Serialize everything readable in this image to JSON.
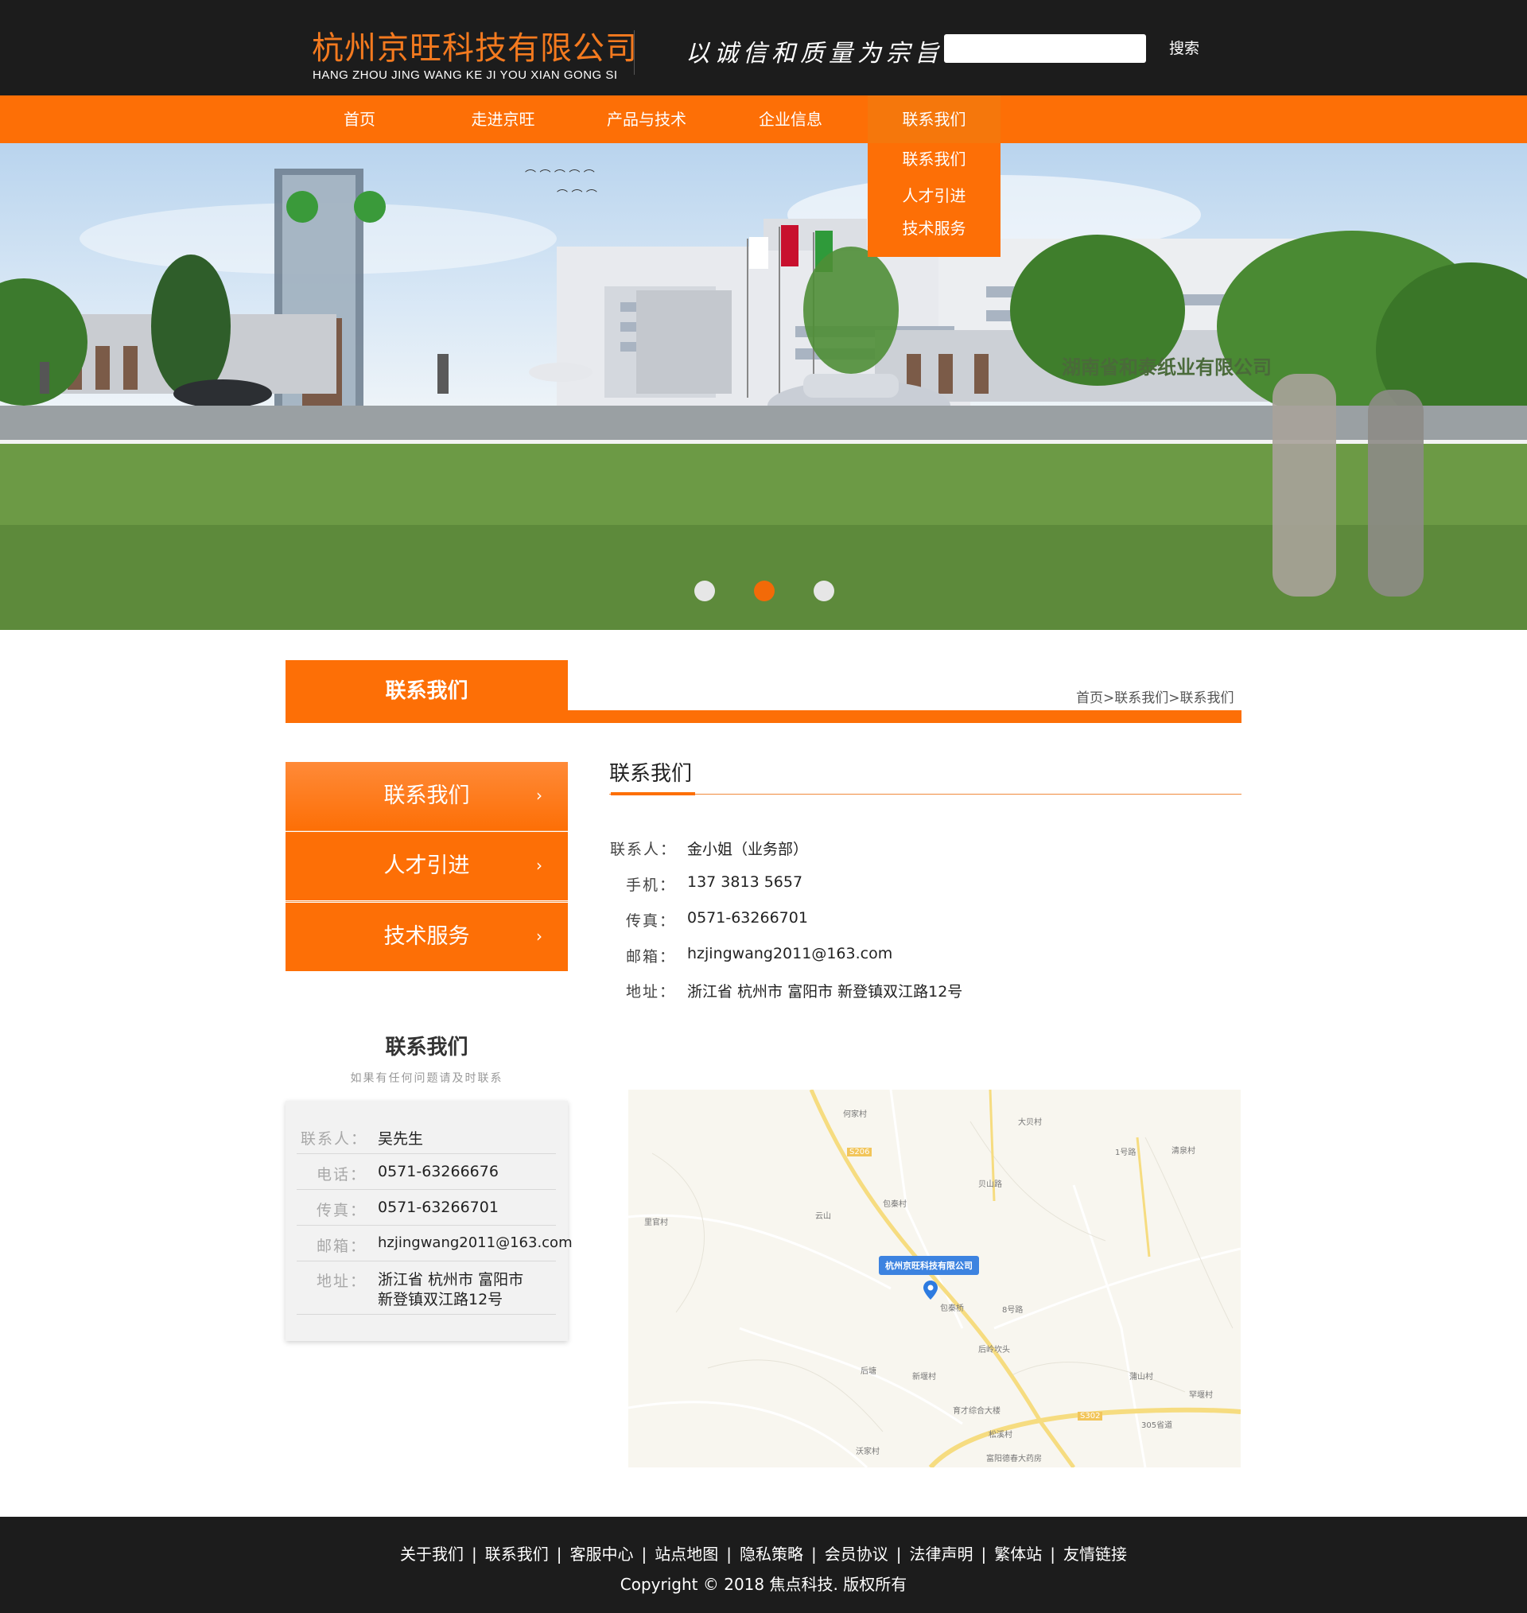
{
  "header": {
    "logo_cn": "杭州京旺科技有限公司",
    "logo_en": "HANG ZHOU JING WANG KE JI YOU XIAN GONG SI",
    "slogan": "以诚信和质量为宗旨",
    "search_placeholder": "",
    "search_label": "搜索"
  },
  "nav": {
    "items": [
      "首页",
      "走进京旺",
      "产品与技术",
      "企业信息",
      "联系我们"
    ],
    "active_index": 4,
    "dropdown": [
      "联系我们",
      "人才引进",
      "技术服务"
    ]
  },
  "banner": {
    "building_sign": "湖南省和泰纸业有限公司",
    "slides": 3,
    "active_slide": 2
  },
  "section": {
    "title": "联系我们",
    "breadcrumb": [
      "首页",
      ">",
      "联系我们",
      ">",
      "联系我们"
    ]
  },
  "sidebar": {
    "menu": [
      "联系我们",
      "人才引进",
      "技术服务"
    ],
    "chevron": "›",
    "box": {
      "title": "联系我们",
      "subtitle": "如果有任何问题请及时联系",
      "rows": [
        {
          "label": "联系人：",
          "value": "吴先生"
        },
        {
          "label": "电话：",
          "value": "0571-63266676"
        },
        {
          "label": "传真：",
          "value": "0571-63266701"
        },
        {
          "label": "邮箱：",
          "value": "hzjingwang2011@163.com"
        },
        {
          "label": "地址：",
          "value": "浙江省 杭州市 富阳市",
          "value2": "新登镇双江路12号"
        }
      ]
    }
  },
  "main": {
    "title": "联系我们",
    "info": [
      {
        "label": "联系人：",
        "value": "金小姐（业务部）"
      },
      {
        "label": "手机：",
        "value": "137 3813 5657"
      },
      {
        "label": "传真：",
        "value": "0571-63266701"
      },
      {
        "label": "邮箱：",
        "value": "hzjingwang2011@163.com"
      },
      {
        "label": "地址：",
        "value": "浙江省 杭州市 富阳市 新登镇双江路12号"
      }
    ],
    "map": {
      "pin_label": "杭州京旺科技有限公司",
      "places": [
        "何家村",
        "大贝村",
        "清泉村",
        "S206",
        "云山",
        "包秦村",
        "贝山路",
        "1号路",
        "里官村",
        "包秦桥",
        "8号路",
        "后岭坎头",
        "后塘",
        "新堰村",
        "蒲山村",
        "罕堰村",
        "育才综合大楼",
        "S302",
        "305省道",
        "松溪村",
        "沃家村",
        "富阳德春大药房"
      ]
    }
  },
  "footer": {
    "links": [
      "关于我们",
      "联系我们",
      "客服中心",
      "站点地图",
      "隐私策略",
      "会员协议",
      "法律声明",
      "繁体站",
      "友情链接"
    ],
    "separator": "|",
    "copyright": "Copyright © 2018 焦点科技. 版权所有"
  },
  "colors": {
    "accent": "#fd6f06",
    "header_bg": "#1c1c1c",
    "dot_active": "#f26a08"
  }
}
